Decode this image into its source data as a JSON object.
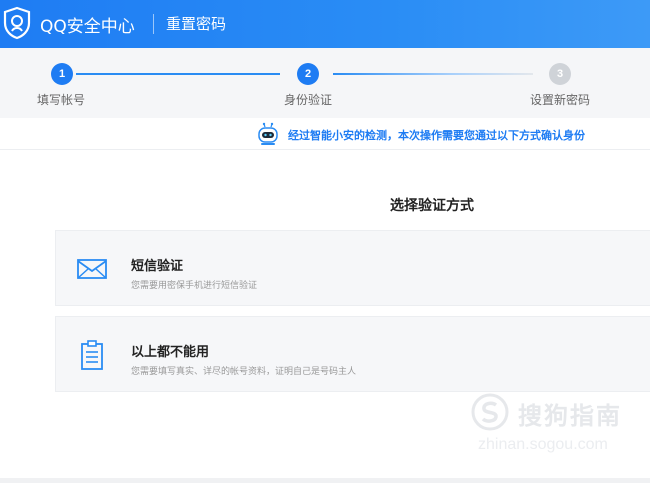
{
  "header": {
    "app_title": "QQ安全中心",
    "page_title": "重置密码",
    "logo_icon": "shield-icon",
    "color": "#1e7cf3"
  },
  "steps": [
    {
      "number": "1",
      "label": "填写帐号",
      "state": "done"
    },
    {
      "number": "2",
      "label": "身份验证",
      "state": "current"
    },
    {
      "number": "3",
      "label": "设置新密码",
      "state": "pending"
    }
  ],
  "notice": {
    "icon": "robot-icon",
    "text": "经过智能小安的检测，本次操作需要您通过以下方式确认身份"
  },
  "main": {
    "section_title": "选择验证方式",
    "options": [
      {
        "icon": "envelope-icon",
        "title": "短信验证",
        "desc": "您需要用密保手机进行短信验证"
      },
      {
        "icon": "clipboard-icon",
        "title": "以上都不能用",
        "desc": "您需要填写真实、详尽的帐号资料，证明自己是号码主人"
      }
    ]
  },
  "watermark": {
    "text": "搜狗指南",
    "url": "zhinan.sogou.com"
  }
}
